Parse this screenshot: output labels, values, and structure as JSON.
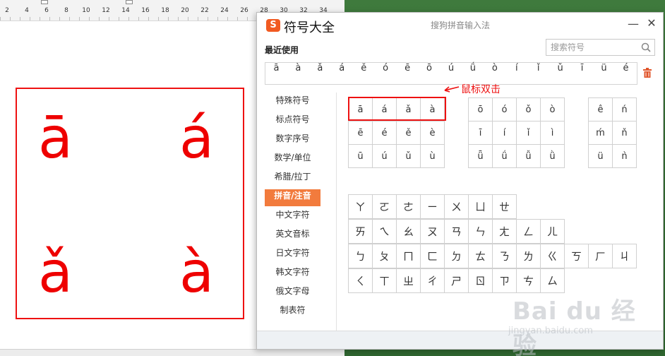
{
  "ruler": {
    "numbers": [
      "2",
      "4",
      "6",
      "8",
      "10",
      "12",
      "14",
      "16",
      "18",
      "20",
      "22",
      "24",
      "26",
      "28",
      "30",
      "32",
      "34"
    ]
  },
  "document": {
    "chars": [
      "ā",
      "á",
      "ǎ",
      "à"
    ]
  },
  "window": {
    "title": "符号大全",
    "ime_name": "搜狗拼音输入法",
    "minimize_glyph": "—",
    "close_glyph": "✕"
  },
  "recent": {
    "title": "最近使用",
    "symbols": [
      "ā",
      "à",
      "ǎ",
      "á",
      "ě",
      "ó",
      "ē",
      "ō",
      "ú",
      "ǘ",
      "ò",
      "í",
      "ǐ",
      "ǔ",
      "ī",
      "ü",
      "é"
    ]
  },
  "search": {
    "placeholder": "搜索符号"
  },
  "categories": [
    {
      "label": "特殊符号"
    },
    {
      "label": "标点符号"
    },
    {
      "label": "数字序号"
    },
    {
      "label": "数学/单位"
    },
    {
      "label": "希腊/拉丁"
    },
    {
      "label": "拼音/注音",
      "active": true
    },
    {
      "label": "中文字符"
    },
    {
      "label": "英文音标"
    },
    {
      "label": "日文字符"
    },
    {
      "label": "韩文字符"
    },
    {
      "label": "俄文字母"
    },
    {
      "label": "制表符"
    }
  ],
  "pinyin": {
    "group_a": [
      "ā",
      "á",
      "ǎ",
      "à",
      "ē",
      "é",
      "ě",
      "è",
      "ū",
      "ú",
      "ǔ",
      "ù"
    ],
    "group_o": [
      "ō",
      "ó",
      "ǒ",
      "ò",
      "ī",
      "í",
      "ǐ",
      "ì",
      "ǖ",
      "ǘ",
      "ǚ",
      "ǜ"
    ],
    "group_e": [
      "ê",
      "ń",
      "ḿ",
      "ň",
      "ü",
      "ǹ"
    ]
  },
  "zhuyin": {
    "row1": [
      "ㄚ",
      "ㄛ",
      "ㄜ",
      "ㄧ",
      "ㄨ",
      "ㄩ",
      "ㄝ"
    ],
    "row2": [
      "ㄞ",
      "ㄟ",
      "ㄠ",
      "ㄡ",
      "ㄢ",
      "ㄣ",
      "ㄤ",
      "ㄥ",
      "ㄦ"
    ],
    "row3": [
      "ㄅ",
      "ㄆ",
      "ㄇ",
      "ㄈ",
      "ㄉ",
      "ㄊ",
      "ㄋ",
      "ㄌ",
      "ㄍ",
      "ㄎ",
      "ㄏ",
      "ㄐ"
    ],
    "row4": [
      "ㄑ",
      "ㄒ",
      "ㄓ",
      "ㄔ",
      "ㄕ",
      "ㄖ",
      "ㄗ",
      "ㄘ",
      "ㄙ"
    ]
  },
  "annotation": {
    "text": "鼠标双击"
  },
  "watermark": {
    "main": "Bai du 经验",
    "sub": "jingyan.baidu.com"
  },
  "colors": {
    "accent": "#f27b3d",
    "highlight": "#ee1111"
  }
}
